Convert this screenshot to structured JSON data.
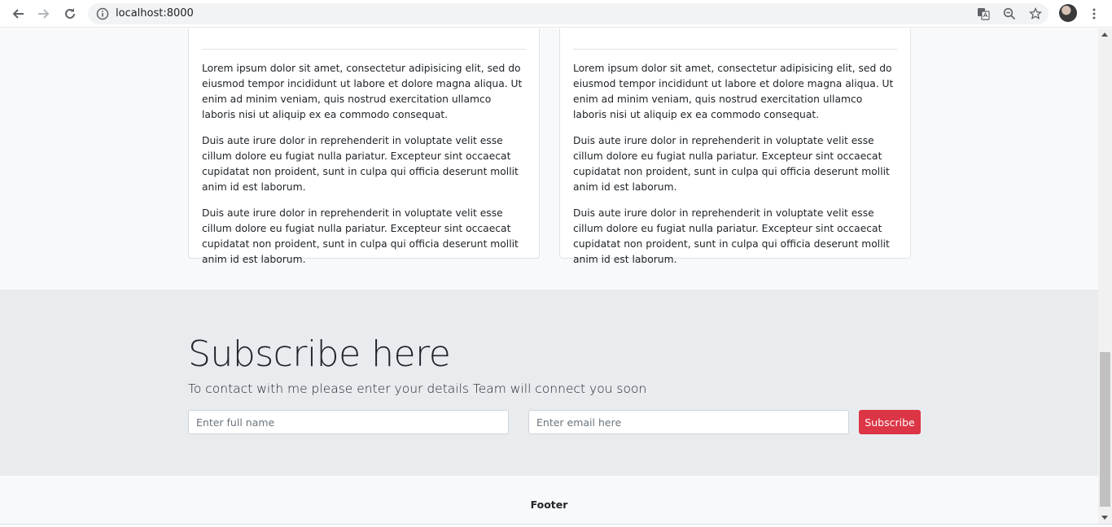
{
  "browser": {
    "url": "localhost:8000"
  },
  "cards": [
    {
      "paragraphs": [
        "Lorem ipsum dolor sit amet, consectetur adipisicing elit, sed do eiusmod tempor incididunt ut labore et dolore magna aliqua. Ut enim ad minim veniam, quis nostrud exercitation ullamco laboris nisi ut aliquip ex ea commodo consequat.",
        "Duis aute irure dolor in reprehenderit in voluptate velit esse cillum dolore eu fugiat nulla pariatur. Excepteur sint occaecat cupidatat non proident, sunt in culpa qui officia deserunt mollit anim id est laborum.",
        "Duis aute irure dolor in reprehenderit in voluptate velit esse cillum dolore eu fugiat nulla pariatur. Excepteur sint occaecat cupidatat non proident, sunt in culpa qui officia deserunt mollit anim id est laborum."
      ]
    },
    {
      "paragraphs": [
        "Lorem ipsum dolor sit amet, consectetur adipisicing elit, sed do eiusmod tempor incididunt ut labore et dolore magna aliqua. Ut enim ad minim veniam, quis nostrud exercitation ullamco laboris nisi ut aliquip ex ea commodo consequat.",
        "Duis aute irure dolor in reprehenderit in voluptate velit esse cillum dolore eu fugiat nulla pariatur. Excepteur sint occaecat cupidatat non proident, sunt in culpa qui officia deserunt mollit anim id est laborum.",
        "Duis aute irure dolor in reprehenderit in voluptate velit esse cillum dolore eu fugiat nulla pariatur. Excepteur sint occaecat cupidatat non proident, sunt in culpa qui officia deserunt mollit anim id est laborum."
      ]
    }
  ],
  "subscribe": {
    "title": "Subscribe here",
    "lead": "To contact with me please enter your details Team will connect you soon",
    "name_placeholder": "Enter full name",
    "email_placeholder": "Enter email here",
    "button_label": "Subscribe",
    "button_color": "#dc3545"
  },
  "footer": {
    "text": "Footer"
  },
  "icons": {
    "back": "arrow-left-icon",
    "forward": "arrow-right-icon",
    "reload": "reload-icon",
    "info": "info-icon",
    "translate": "translate-icon",
    "zoom": "zoom-icon",
    "bookmark": "star-icon",
    "menu": "kebab-menu-icon"
  }
}
